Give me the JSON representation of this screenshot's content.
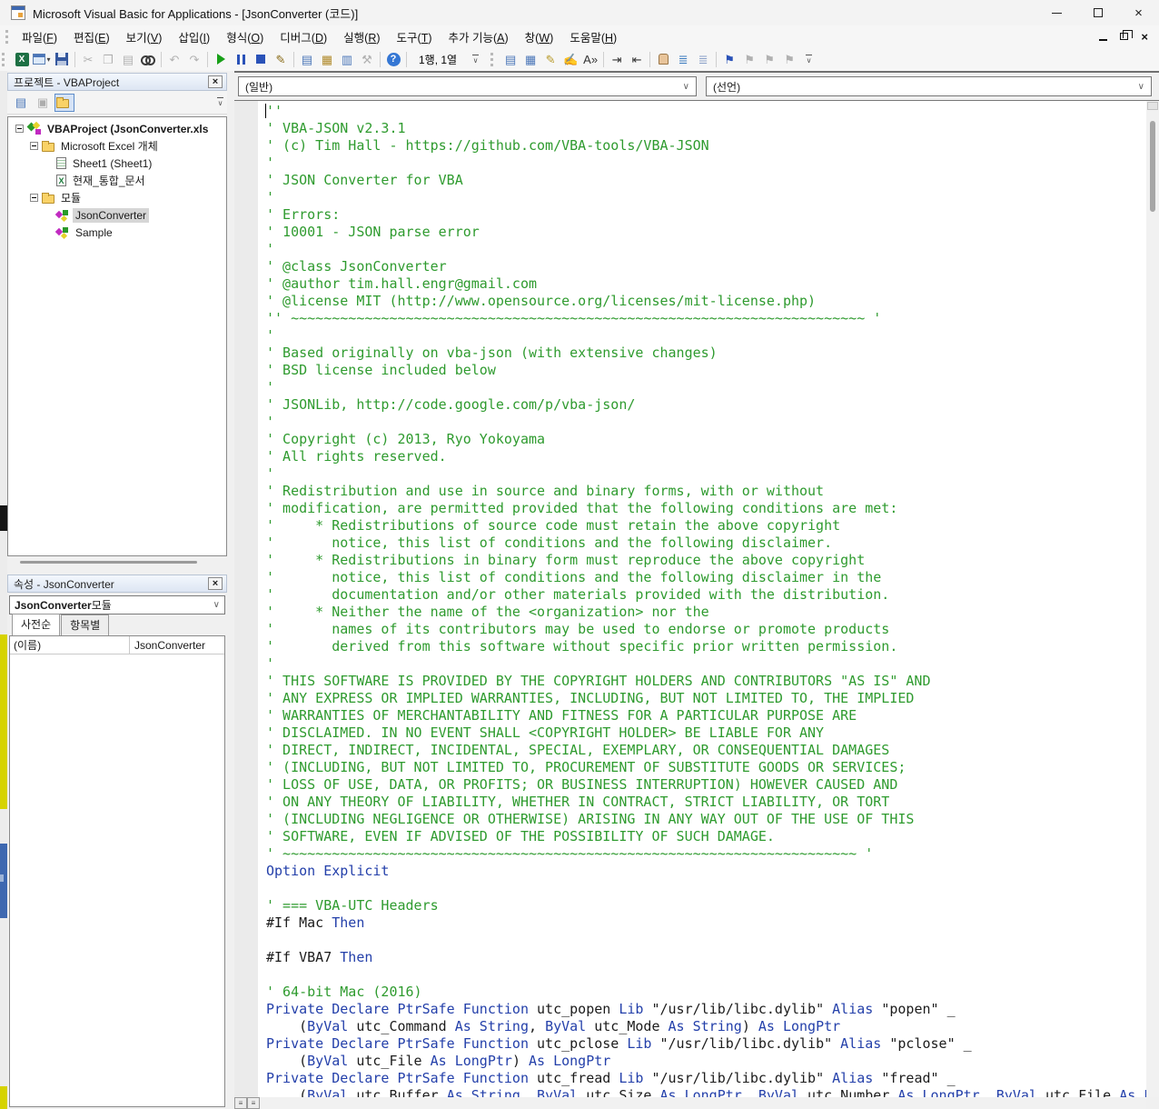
{
  "window": {
    "title": "Microsoft Visual Basic for Applications - [JsonConverter (코드)]"
  },
  "menu": {
    "items": [
      {
        "text": "파일",
        "key": "F"
      },
      {
        "text": "편집",
        "key": "E"
      },
      {
        "text": "보기",
        "key": "V"
      },
      {
        "text": "삽입",
        "key": "I"
      },
      {
        "text": "형식",
        "key": "O"
      },
      {
        "text": "디버그",
        "key": "D"
      },
      {
        "text": "실행",
        "key": "R"
      },
      {
        "text": "도구",
        "key": "T"
      },
      {
        "text": "추가 기능",
        "key": "A"
      },
      {
        "text": "창",
        "key": "W"
      },
      {
        "text": "도움말",
        "key": "H"
      }
    ]
  },
  "toolbars": {
    "position_indicator": "1행, 1열",
    "standard": [
      {
        "name": "view-host-excel",
        "icon": "excel-icon",
        "css": "i-excel",
        "glyph": "X"
      },
      {
        "name": "insert-userform",
        "icon": "userform-icon",
        "css": "i-form",
        "dropdown": true
      },
      {
        "name": "save",
        "icon": "save-icon",
        "css": "i-save"
      },
      {
        "sep": true
      },
      {
        "name": "cut",
        "icon": "scissors-icon",
        "glyph": "✂",
        "disabled": true
      },
      {
        "name": "copy",
        "icon": "copy-icon",
        "glyph": "❐",
        "disabled": true
      },
      {
        "name": "paste",
        "icon": "paste-icon",
        "glyph": "▤",
        "disabled": true
      },
      {
        "name": "find",
        "icon": "binoculars-icon",
        "css": "i-find"
      },
      {
        "sep": true
      },
      {
        "name": "undo",
        "icon": "undo-icon",
        "glyph": "↶",
        "disabled": true
      },
      {
        "name": "redo",
        "icon": "redo-icon",
        "glyph": "↷",
        "disabled": true
      },
      {
        "sep": true
      },
      {
        "name": "run",
        "icon": "run-icon",
        "css": "i-run"
      },
      {
        "name": "break",
        "icon": "pause-icon",
        "css": "i-pause",
        "bars": true
      },
      {
        "name": "reset",
        "icon": "stop-icon",
        "css": "i-stop"
      },
      {
        "name": "design-mode",
        "icon": "design-mode-icon",
        "glyph": "✎",
        "color": "#8a6d1a"
      },
      {
        "sep": true
      },
      {
        "name": "project-explorer",
        "icon": "project-explorer-icon",
        "glyph": "▤",
        "color": "#4a76b8"
      },
      {
        "name": "properties-window",
        "icon": "properties-window-icon",
        "glyph": "▦",
        "color": "#b08a2a"
      },
      {
        "name": "object-browser",
        "icon": "object-browser-icon",
        "glyph": "▥",
        "color": "#4a76b8"
      },
      {
        "name": "toolbox",
        "icon": "toolbox-icon",
        "glyph": "⚒",
        "disabled": true
      },
      {
        "sep": true
      },
      {
        "name": "help",
        "icon": "help-icon",
        "glyph": "?",
        "css2": "help"
      },
      {
        "sep": true
      },
      {
        "text": "1행, 1열",
        "name": "cursor-position"
      }
    ],
    "edit": [
      {
        "name": "list-properties",
        "icon": "list-properties-icon",
        "glyph": "▤",
        "color": "#4a76b8"
      },
      {
        "name": "list-constants",
        "icon": "list-constants-icon",
        "glyph": "▦",
        "color": "#4a76b8"
      },
      {
        "name": "quick-info",
        "icon": "quick-info-icon",
        "glyph": "✎",
        "color": "#b89a2a"
      },
      {
        "name": "parameter-info",
        "icon": "parameter-info-icon",
        "glyph": "✍",
        "color": "#4a76b8"
      },
      {
        "name": "complete-word",
        "icon": "complete-word-icon",
        "glyph": "A»",
        "color": "#333333"
      },
      {
        "sep": true
      },
      {
        "name": "indent",
        "icon": "indent-icon",
        "glyph": "⇥",
        "color": "#333333"
      },
      {
        "name": "outdent",
        "icon": "outdent-icon",
        "glyph": "⇤",
        "color": "#333333"
      },
      {
        "sep": true
      },
      {
        "name": "toggle-breakpoint",
        "icon": "hand-icon",
        "css": "i-hand"
      },
      {
        "name": "comment-block",
        "icon": "comment-block-icon",
        "glyph": "≣",
        "color": "#3a7abf"
      },
      {
        "name": "uncomment-block",
        "icon": "uncomment-block-icon",
        "glyph": "≣",
        "color": "#8aa0c8"
      },
      {
        "sep": true
      },
      {
        "name": "toggle-bookmark",
        "icon": "bookmark-flag-icon",
        "glyph": "⚑",
        "color": "#2a52b8"
      },
      {
        "name": "next-bookmark",
        "icon": "bookmark-next-icon",
        "glyph": "⚑",
        "disabled": true
      },
      {
        "name": "previous-bookmark",
        "icon": "bookmark-prev-icon",
        "glyph": "⚑",
        "disabled": true
      },
      {
        "name": "clear-bookmarks",
        "icon": "bookmark-clear-icon",
        "glyph": "⚑",
        "disabled": true
      }
    ]
  },
  "project_panel": {
    "title": "프로젝트 - VBAProject",
    "toolbar": [
      {
        "name": "view-code",
        "glyph": "▤",
        "color": "#4a76b8"
      },
      {
        "name": "view-object",
        "glyph": "▣",
        "disabled": true
      },
      {
        "name": "toggle-folders",
        "folder": true,
        "active": true
      }
    ],
    "tree": [
      {
        "level": 0,
        "expand": true,
        "icon": "project",
        "label": "VBAProject (JsonConverter.xls",
        "bold": true
      },
      {
        "level": 1,
        "expand": true,
        "icon": "folder",
        "label": "Microsoft Excel 개체"
      },
      {
        "level": 2,
        "icon": "sheet",
        "label": "Sheet1 (Sheet1)"
      },
      {
        "level": 2,
        "icon": "workbook",
        "label": "현재_통합_문서"
      },
      {
        "level": 1,
        "expand": true,
        "icon": "folder",
        "label": "모듈"
      },
      {
        "level": 2,
        "icon": "module",
        "label": "JsonConverter",
        "selected": true
      },
      {
        "level": 2,
        "icon": "module",
        "label": "Sample"
      }
    ]
  },
  "properties_panel": {
    "title": "속성 - JsonConverter",
    "selector_bold": "JsonConverter",
    "selector_rest": " 모듈",
    "tabs": [
      {
        "label": "사전순",
        "active": true
      },
      {
        "label": "항목별",
        "active": false
      }
    ],
    "rows": [
      {
        "name": "(이름)",
        "value": "JsonConverter"
      }
    ]
  },
  "code_window": {
    "general_dropdown": "(일반)",
    "declarations_dropdown": "(선언)",
    "lines": [
      [
        [
          "c",
          "''"
        ]
      ],
      [
        [
          "c",
          "' VBA-JSON v2.3.1"
        ]
      ],
      [
        [
          "c",
          "' (c) Tim Hall - https://github.com/VBA-tools/VBA-JSON"
        ]
      ],
      [
        [
          "c",
          "'"
        ]
      ],
      [
        [
          "c",
          "' JSON Converter for VBA"
        ]
      ],
      [
        [
          "c",
          "'"
        ]
      ],
      [
        [
          "c",
          "' Errors:"
        ]
      ],
      [
        [
          "c",
          "' 10001 - JSON parse error"
        ]
      ],
      [
        [
          "c",
          "'"
        ]
      ],
      [
        [
          "c",
          "' @class JsonConverter"
        ]
      ],
      [
        [
          "c",
          "' @author tim.hall.engr@gmail.com"
        ]
      ],
      [
        [
          "c",
          "' @license MIT (http://www.opensource.org/licenses/mit-license.php)"
        ]
      ],
      [
        [
          "c",
          "'' ~~~~~~~~~~~~~~~~~~~~~~~~~~~~~~~~~~~~~~~~~~~~~~~~~~~~~~~~~~~~~~~~~~~~~~ '"
        ]
      ],
      [
        [
          "c",
          "'"
        ]
      ],
      [
        [
          "c",
          "' Based originally on vba-json (with extensive changes)"
        ]
      ],
      [
        [
          "c",
          "' BSD license included below"
        ]
      ],
      [
        [
          "c",
          "'"
        ]
      ],
      [
        [
          "c",
          "' JSONLib, http://code.google.com/p/vba-json/"
        ]
      ],
      [
        [
          "c",
          "'"
        ]
      ],
      [
        [
          "c",
          "' Copyright (c) 2013, Ryo Yokoyama"
        ]
      ],
      [
        [
          "c",
          "' All rights reserved."
        ]
      ],
      [
        [
          "c",
          "'"
        ]
      ],
      [
        [
          "c",
          "' Redistribution and use in source and binary forms, with or without"
        ]
      ],
      [
        [
          "c",
          "' modification, are permitted provided that the following conditions are met:"
        ]
      ],
      [
        [
          "c",
          "'     * Redistributions of source code must retain the above copyright"
        ]
      ],
      [
        [
          "c",
          "'       notice, this list of conditions and the following disclaimer."
        ]
      ],
      [
        [
          "c",
          "'     * Redistributions in binary form must reproduce the above copyright"
        ]
      ],
      [
        [
          "c",
          "'       notice, this list of conditions and the following disclaimer in the"
        ]
      ],
      [
        [
          "c",
          "'       documentation and/or other materials provided with the distribution."
        ]
      ],
      [
        [
          "c",
          "'     * Neither the name of the <organization> nor the"
        ]
      ],
      [
        [
          "c",
          "'       names of its contributors may be used to endorse or promote products"
        ]
      ],
      [
        [
          "c",
          "'       derived from this software without specific prior written permission."
        ]
      ],
      [
        [
          "c",
          "'"
        ]
      ],
      [
        [
          "c",
          "' THIS SOFTWARE IS PROVIDED BY THE COPYRIGHT HOLDERS AND CONTRIBUTORS \"AS IS\" AND"
        ]
      ],
      [
        [
          "c",
          "' ANY EXPRESS OR IMPLIED WARRANTIES, INCLUDING, BUT NOT LIMITED TO, THE IMPLIED"
        ]
      ],
      [
        [
          "c",
          "' WARRANTIES OF MERCHANTABILITY AND FITNESS FOR A PARTICULAR PURPOSE ARE"
        ]
      ],
      [
        [
          "c",
          "' DISCLAIMED. IN NO EVENT SHALL <COPYRIGHT HOLDER> BE LIABLE FOR ANY"
        ]
      ],
      [
        [
          "c",
          "' DIRECT, INDIRECT, INCIDENTAL, SPECIAL, EXEMPLARY, OR CONSEQUENTIAL DAMAGES"
        ]
      ],
      [
        [
          "c",
          "' (INCLUDING, BUT NOT LIMITED TO, PROCUREMENT OF SUBSTITUTE GOODS OR SERVICES;"
        ]
      ],
      [
        [
          "c",
          "' LOSS OF USE, DATA, OR PROFITS; OR BUSINESS INTERRUPTION) HOWEVER CAUSED AND"
        ]
      ],
      [
        [
          "c",
          "' ON ANY THEORY OF LIABILITY, WHETHER IN CONTRACT, STRICT LIABILITY, OR TORT"
        ]
      ],
      [
        [
          "c",
          "' (INCLUDING NEGLIGENCE OR OTHERWISE) ARISING IN ANY WAY OUT OF THE USE OF THIS"
        ]
      ],
      [
        [
          "c",
          "' SOFTWARE, EVEN IF ADVISED OF THE POSSIBILITY OF SUCH DAMAGE."
        ]
      ],
      [
        [
          "c",
          "' ~~~~~~~~~~~~~~~~~~~~~~~~~~~~~~~~~~~~~~~~~~~~~~~~~~~~~~~~~~~~~~~~~~~~~~ '"
        ]
      ],
      [
        [
          "k",
          "Option Explicit"
        ]
      ],
      [],
      [
        [
          "c",
          "' === VBA-UTC Headers"
        ]
      ],
      [
        [
          "n",
          "#If Mac "
        ],
        [
          "k",
          "Then"
        ]
      ],
      [],
      [
        [
          "n",
          "#If VBA7 "
        ],
        [
          "k",
          "Then"
        ]
      ],
      [],
      [
        [
          "c",
          "' 64-bit Mac (2016)"
        ]
      ],
      [
        [
          "k",
          "Private Declare PtrSafe Function"
        ],
        [
          "n",
          " utc_popen "
        ],
        [
          "k",
          "Lib"
        ],
        [
          "n",
          " \"/usr/lib/libc.dylib\" "
        ],
        [
          "k",
          "Alias"
        ],
        [
          "n",
          " \"popen\" _"
        ]
      ],
      [
        [
          "n",
          "    ("
        ],
        [
          "k",
          "ByVal"
        ],
        [
          "n",
          " utc_Command "
        ],
        [
          "k",
          "As String"
        ],
        [
          "n",
          ", "
        ],
        [
          "k",
          "ByVal"
        ],
        [
          "n",
          " utc_Mode "
        ],
        [
          "k",
          "As String"
        ],
        [
          "n",
          ") "
        ],
        [
          "k",
          "As LongPtr"
        ]
      ],
      [
        [
          "k",
          "Private Declare PtrSafe Function"
        ],
        [
          "n",
          " utc_pclose "
        ],
        [
          "k",
          "Lib"
        ],
        [
          "n",
          " \"/usr/lib/libc.dylib\" "
        ],
        [
          "k",
          "Alias"
        ],
        [
          "n",
          " \"pclose\" _"
        ]
      ],
      [
        [
          "n",
          "    ("
        ],
        [
          "k",
          "ByVal"
        ],
        [
          "n",
          " utc_File "
        ],
        [
          "k",
          "As LongPtr"
        ],
        [
          "n",
          ") "
        ],
        [
          "k",
          "As LongPtr"
        ]
      ],
      [
        [
          "k",
          "Private Declare PtrSafe Function"
        ],
        [
          "n",
          " utc_fread "
        ],
        [
          "k",
          "Lib"
        ],
        [
          "n",
          " \"/usr/lib/libc.dylib\" "
        ],
        [
          "k",
          "Alias"
        ],
        [
          "n",
          " \"fread\" _"
        ]
      ],
      [
        [
          "n",
          "    ("
        ],
        [
          "k",
          "ByVal"
        ],
        [
          "n",
          " utc_Buffer "
        ],
        [
          "k",
          "As String"
        ],
        [
          "n",
          ", "
        ],
        [
          "k",
          "ByVal"
        ],
        [
          "n",
          " utc_Size "
        ],
        [
          "k",
          "As LongPtr"
        ],
        [
          "n",
          ", "
        ],
        [
          "k",
          "ByVal"
        ],
        [
          "n",
          " utc_Number "
        ],
        [
          "k",
          "As LongPtr"
        ],
        [
          "n",
          ", "
        ],
        [
          "k",
          "ByVal"
        ],
        [
          "n",
          " utc_File "
        ],
        [
          "k",
          "As L"
        ]
      ]
    ]
  },
  "colors": {
    "comment_green": "#2f9b2f",
    "keyword_blue": "#2440aa",
    "code_black": "#1c1c1c",
    "edge_yellow": "#d6d301",
    "edge_blue": "#3e68b0"
  }
}
